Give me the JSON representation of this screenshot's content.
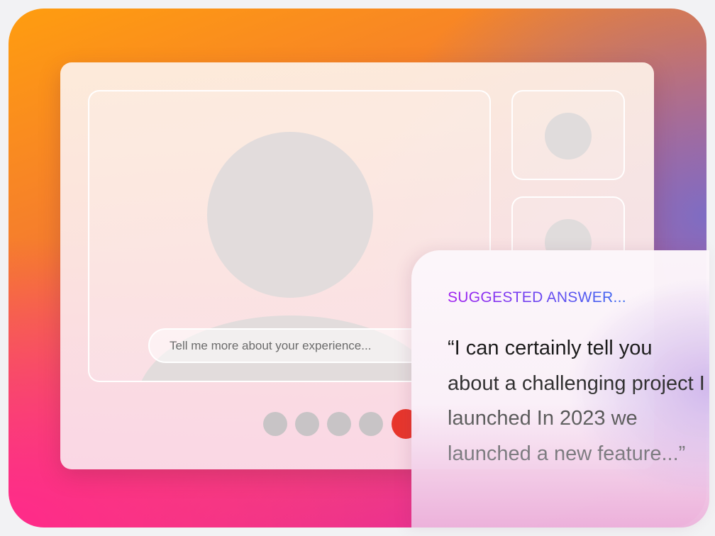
{
  "call": {
    "prompt_text": "Tell me more about your experience...",
    "participants": [
      "main-speaker",
      "participant-2",
      "participant-3"
    ],
    "controls": [
      "control-1",
      "control-2",
      "control-3",
      "control-4",
      "end-call"
    ]
  },
  "suggestion": {
    "label": "SUGGESTED ANSWER...",
    "text": "“I can certainly tell you about a challenging project I launched In 2023 we launched a new feature...”"
  },
  "colors": {
    "end_call": "#e8362c",
    "label_start": "#a020f0",
    "label_end": "#3a6af0"
  }
}
